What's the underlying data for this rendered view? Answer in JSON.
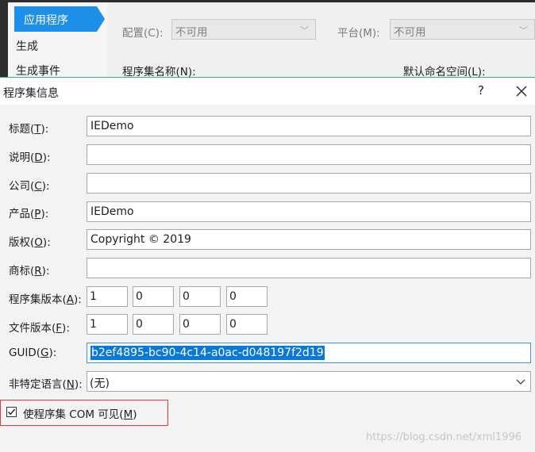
{
  "background": {
    "sidebar": {
      "items": [
        {
          "label": "应用程序",
          "active": true
        },
        {
          "label": "生成"
        },
        {
          "label": "生成事件"
        }
      ]
    },
    "config": {
      "label": "配置(C):",
      "value": "不可用"
    },
    "platform": {
      "label": "平台(M):",
      "value": "不可用"
    },
    "assembly_name_label": "程序集名称(N):",
    "default_namespace_label": "默认命名空间(L):"
  },
  "dialog": {
    "title": "程序集信息",
    "help_label": "?",
    "close_icon": "close-icon",
    "fields": {
      "title": {
        "label": "标题",
        "hotkey": "T",
        "value": "IEDemo"
      },
      "description": {
        "label": "说明",
        "hotkey": "D",
        "value": ""
      },
      "company": {
        "label": "公司",
        "hotkey": "C",
        "value": ""
      },
      "product": {
        "label": "产品",
        "hotkey": "P",
        "value": "IEDemo"
      },
      "copyright": {
        "label": "版权",
        "hotkey": "O",
        "value": "Copyright ©  2019"
      },
      "trademark": {
        "label": "商标",
        "hotkey": "R",
        "value": ""
      }
    },
    "assembly_version": {
      "label": "程序集版本",
      "hotkey": "A",
      "parts": [
        "1",
        "0",
        "0",
        "0"
      ]
    },
    "file_version": {
      "label": "文件版本",
      "hotkey": "F",
      "parts": [
        "1",
        "0",
        "0",
        "0"
      ]
    },
    "guid": {
      "label": "GUID",
      "hotkey": "G",
      "value": "b2ef4895-bc90-4c14-a0ac-d048197f2d19"
    },
    "neutral_language": {
      "label": "非特定语言",
      "hotkey": "N",
      "value": "(无)"
    },
    "com_visible": {
      "label": "使程序集 COM 可见",
      "hotkey": "M",
      "checked": true
    },
    "highlight_color": "#e2383b",
    "selection_color": "#0a78d7"
  },
  "watermark": "https://blog.csdn.net/xml1996"
}
